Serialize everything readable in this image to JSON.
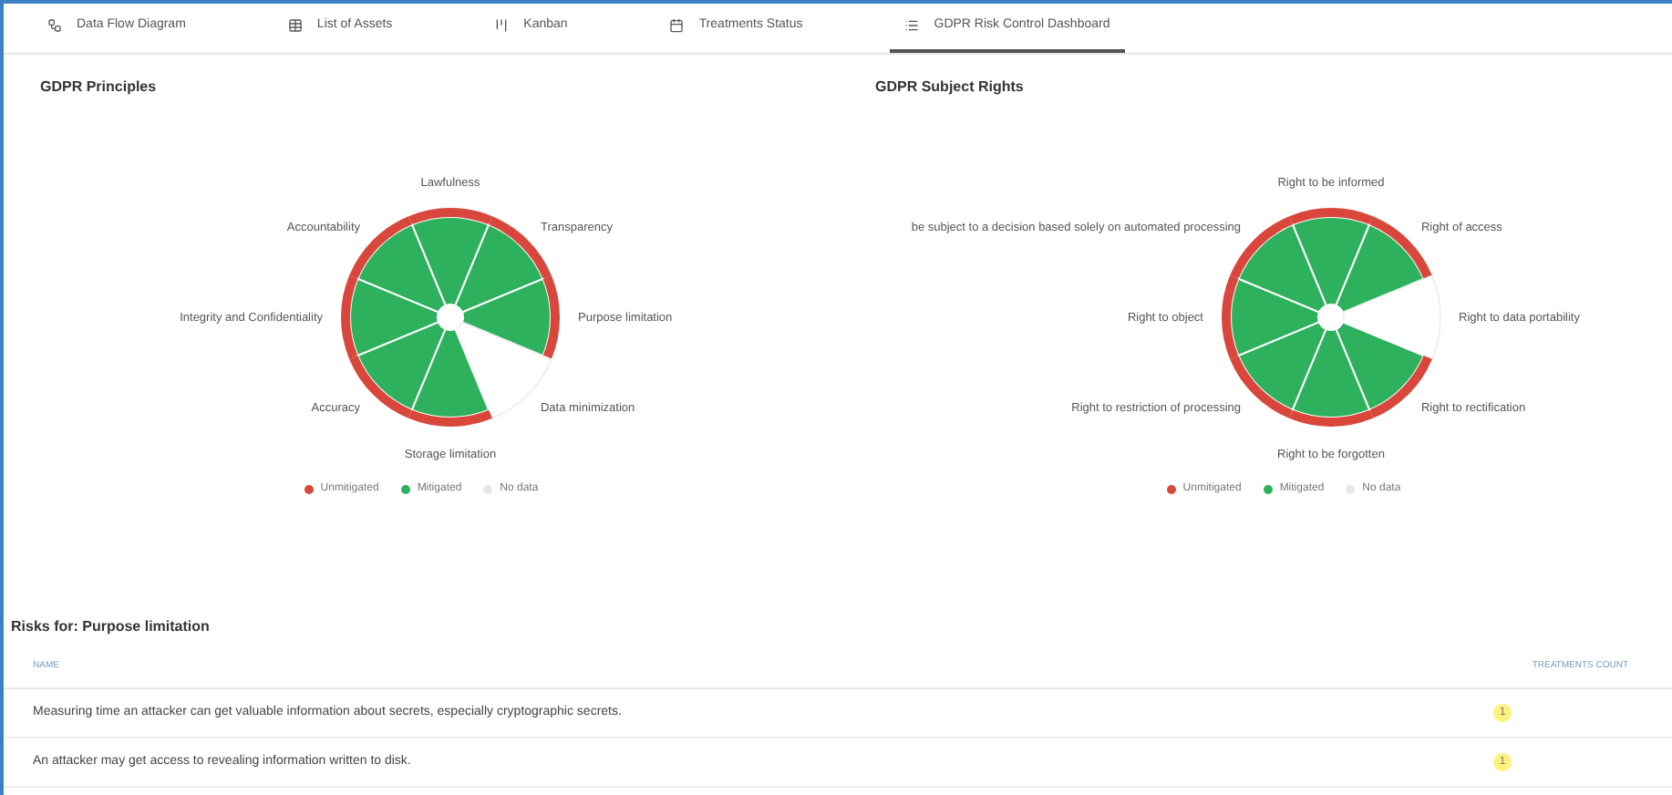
{
  "tabs": [
    {
      "label": "Data Flow Diagram",
      "selected": false
    },
    {
      "label": "List of Assets",
      "selected": false
    },
    {
      "label": "Kanban",
      "selected": false
    },
    {
      "label": "Treatments Status",
      "selected": false
    },
    {
      "label": "GDPR Risk Control Dashboard",
      "selected": true
    }
  ],
  "charts": [
    {
      "title": "GDPR Principles",
      "slices": [
        {
          "label": "Lawfulness",
          "kind": "mitigated"
        },
        {
          "label": "Accountability",
          "kind": "mitigated"
        },
        {
          "label": "Transparency",
          "kind": "mitigated"
        },
        {
          "label": "Integrity and Confidentiality",
          "kind": "mitigated"
        },
        {
          "label": "Purpose limitation",
          "kind": "mitigated"
        },
        {
          "label": "Accuracy",
          "kind": "mitigated"
        },
        {
          "label": "Data minimization",
          "kind": "no-data"
        },
        {
          "label": "Storage limitation",
          "kind": "mitigated"
        }
      ],
      "legend": [
        {
          "label": "Unmitigated",
          "color": "#d9463b"
        },
        {
          "label": "Mitigated",
          "color": "#2eb15d"
        },
        {
          "label": "No data",
          "color": "#e5e7eb"
        }
      ]
    },
    {
      "title": "GDPR Subject Rights",
      "slices": [
        {
          "label": "Right to be informed",
          "kind": "mitigated"
        },
        {
          "label": "be subject to a decision based solely on automated processing",
          "kind": "mitigated"
        },
        {
          "label": "Right of access",
          "kind": "mitigated"
        },
        {
          "label": "Right to object",
          "kind": "mitigated"
        },
        {
          "label": "Right to data portability",
          "kind": "no-data"
        },
        {
          "label": "Right to restriction of processing",
          "kind": "mitigated"
        },
        {
          "label": "Right to rectification",
          "kind": "mitigated"
        },
        {
          "label": "Right to be forgotten",
          "kind": "mitigated"
        }
      ],
      "legend": [
        {
          "label": "Unmitigated",
          "color": "#d9463b"
        },
        {
          "label": "Mitigated",
          "color": "#2eb15d"
        },
        {
          "label": "No data",
          "color": "#e5e7eb"
        }
      ]
    }
  ],
  "risks": {
    "title": "Risks for: Purpose limitation",
    "columns": [
      "NAME",
      "TREATMENTS COUNT"
    ],
    "rows": [
      {
        "name": "Measuring time an attacker can get valuable information about secrets, especially cryptographic secrets.",
        "count": "1"
      },
      {
        "name": "An attacker may get access to revealing information written to disk.",
        "count": "1"
      }
    ]
  }
}
